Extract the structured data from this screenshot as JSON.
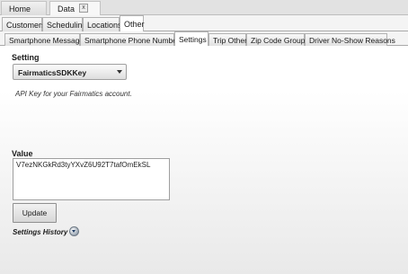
{
  "document_tabs": {
    "home": "Home",
    "data": "Data",
    "close_glyph": "x"
  },
  "category_tabs": [
    "Customers",
    "Scheduling",
    "Locations",
    "Other"
  ],
  "active_category": "Other",
  "sub_tabs": [
    "Smartphone Messages",
    "Smartphone Phone Numbers",
    "Settings",
    "Trip Other",
    "Zip Code Groups",
    "Driver No-Show Reasons"
  ],
  "active_sub_tab": "Settings",
  "setting": {
    "label": "Setting",
    "selected": "FairmaticsSDKKey",
    "description": "API Key for your Fairmatics account."
  },
  "value": {
    "label": "Value",
    "text": "V7ezNKGkRd3tyYXvZ6U92T7tafOmEkSL"
  },
  "buttons": {
    "update": "Update"
  },
  "history": {
    "label": "Settings History",
    "icon": "expand-down-icon"
  }
}
